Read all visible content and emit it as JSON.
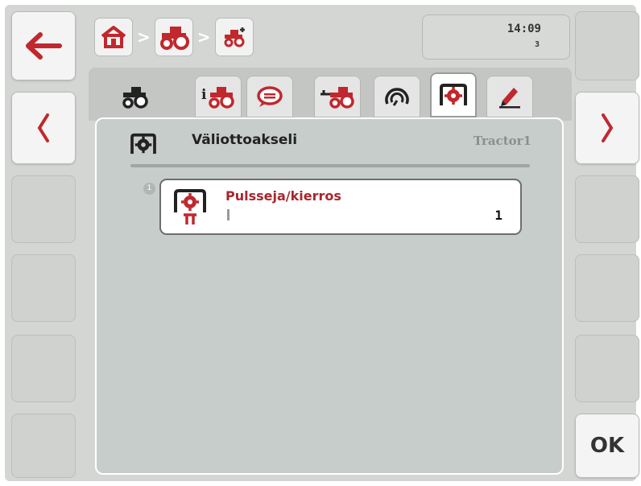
{
  "header": {
    "clock_time": "14:09",
    "clock_sub": "3"
  },
  "breadcrumb": [
    "home-icon",
    "tractor-icon",
    "tractor-small-icon"
  ],
  "tabs": [
    {
      "icon": "tractor-icon",
      "active": false
    },
    {
      "icon": "tractor-info-icon",
      "active": false
    },
    {
      "icon": "speech-bubble-icon",
      "active": false
    },
    {
      "icon": "tractor-hitch-icon",
      "active": false
    },
    {
      "icon": "gauge-icon",
      "active": false
    },
    {
      "icon": "pto-icon",
      "active": true
    },
    {
      "icon": "pencil-icon",
      "active": false
    }
  ],
  "panel": {
    "title": "Väliottoakseli",
    "machine": "Tractor1",
    "params": [
      {
        "index": "1",
        "label": "Pulsseja/kierros",
        "value": "1"
      }
    ]
  },
  "softkeys": {
    "ok_label": "OK"
  },
  "colors": {
    "accent_red": "#c0282e",
    "param_label": "#a8262e"
  }
}
